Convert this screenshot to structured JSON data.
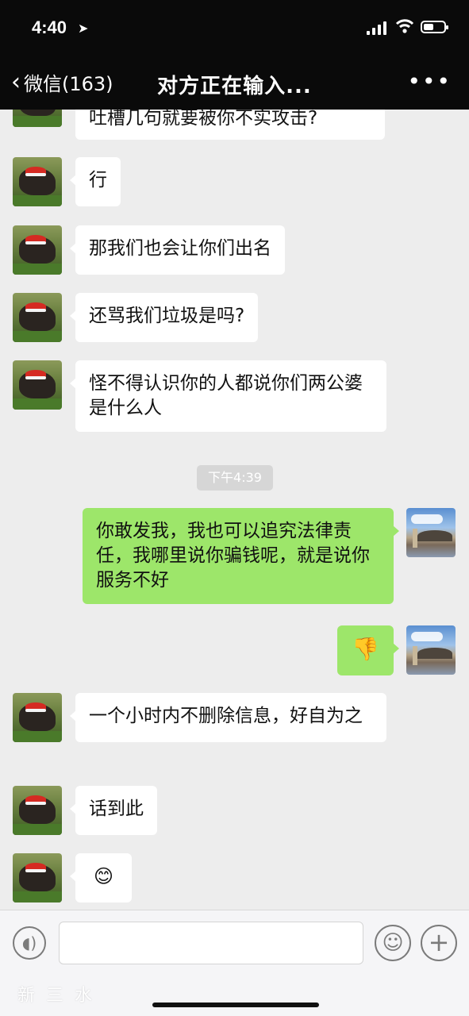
{
  "status_bar": {
    "time": "4:40",
    "location_arrow": "location-icon",
    "signal": "signal-icon",
    "wifi": "wifi-icon",
    "battery": "battery-icon"
  },
  "nav": {
    "back_label": "微信(163)",
    "title": "对方正在输入...",
    "more": "•••"
  },
  "messages": [
    {
      "side": "in",
      "text": "吐槽几句就要被你不实攻击?"
    },
    {
      "side": "in",
      "text": "行"
    },
    {
      "side": "in",
      "text": "那我们也会让你们出名"
    },
    {
      "side": "in",
      "text": "还骂我们垃圾是吗?"
    },
    {
      "side": "in",
      "text": "怪不得认识你的人都说你们两公婆是什么人"
    },
    {
      "side": "out",
      "text": "你敢发我，我也可以追究法律责任，我哪里说你骗钱呢，就是说你服务不好"
    },
    {
      "side": "out",
      "text": "👎"
    },
    {
      "side": "in",
      "text": "一个小时内不删除信息，好自为之"
    },
    {
      "side": "in",
      "text": "话到此"
    },
    {
      "side": "in",
      "text": "😊"
    }
  ],
  "time_divider": "下午4:39",
  "input_bar": {
    "voice_icon": "voice-icon",
    "emoji_icon": "emoji-icon",
    "plus_icon": "plus-icon",
    "text_value": ""
  },
  "watermark": "新三水",
  "colors": {
    "nav_bg": "#0a0a0a",
    "chat_bg": "#ededed",
    "out_bubble": "#9de66a",
    "in_bubble": "#ffffff"
  }
}
